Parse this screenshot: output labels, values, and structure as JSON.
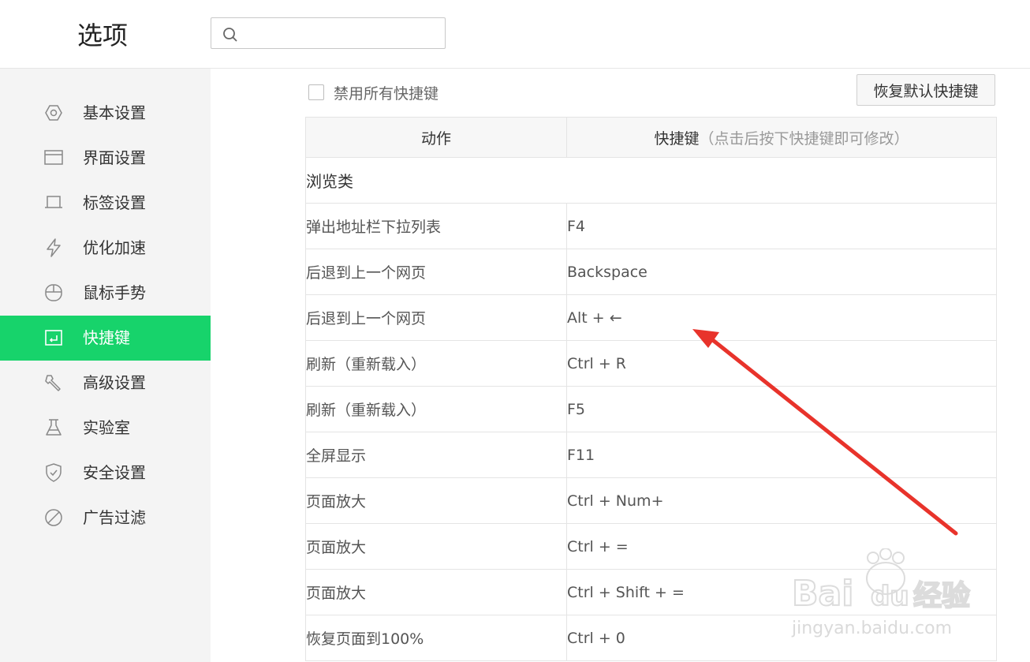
{
  "header": {
    "title": "选项",
    "search_placeholder": "",
    "search_value": ""
  },
  "sidebar": {
    "items": [
      {
        "label": "基本设置",
        "icon": "hexagon-icon",
        "active": false
      },
      {
        "label": "界面设置",
        "icon": "window-icon",
        "active": false
      },
      {
        "label": "标签设置",
        "icon": "tab-icon",
        "active": false
      },
      {
        "label": "优化加速",
        "icon": "lightning-icon",
        "active": false
      },
      {
        "label": "鼠标手势",
        "icon": "mouse-icon",
        "active": false
      },
      {
        "label": "快捷键",
        "icon": "keyboard-enter-icon",
        "active": true
      },
      {
        "label": "高级设置",
        "icon": "wrench-icon",
        "active": false
      },
      {
        "label": "实验室",
        "icon": "flask-icon",
        "active": false
      },
      {
        "label": "安全设置",
        "icon": "shield-icon",
        "active": false
      },
      {
        "label": "广告过滤",
        "icon": "block-icon",
        "active": false
      }
    ]
  },
  "toolbar": {
    "disable_all_label": "禁用所有快捷键",
    "disable_all_checked": false,
    "restore_label": "恢复默认快捷键"
  },
  "table": {
    "col_action": "动作",
    "col_key": "快捷键",
    "col_key_hint": "（点击后按下快捷键即可修改）",
    "category": "浏览类",
    "rows": [
      {
        "action": "弹出地址栏下拉列表",
        "key": "F4"
      },
      {
        "action": "后退到上一个网页",
        "key": "Backspace"
      },
      {
        "action": "后退到上一个网页",
        "key": "Alt + ←"
      },
      {
        "action": "刷新（重新载入）",
        "key": "Ctrl + R"
      },
      {
        "action": "刷新（重新载入）",
        "key": "F5"
      },
      {
        "action": "全屏显示",
        "key": "F11"
      },
      {
        "action": "页面放大",
        "key": "Ctrl + Num+"
      },
      {
        "action": "页面放大",
        "key": "Ctrl + ="
      },
      {
        "action": "页面放大",
        "key": "Ctrl + Shift + ="
      },
      {
        "action": "恢复页面到100%",
        "key": "Ctrl + 0"
      }
    ]
  },
  "watermark": {
    "brand": "Bai du 经验",
    "url": "jingyan.baidu.com"
  },
  "colors": {
    "accent": "#17d36b",
    "annotation_arrow": "#e8332b"
  }
}
